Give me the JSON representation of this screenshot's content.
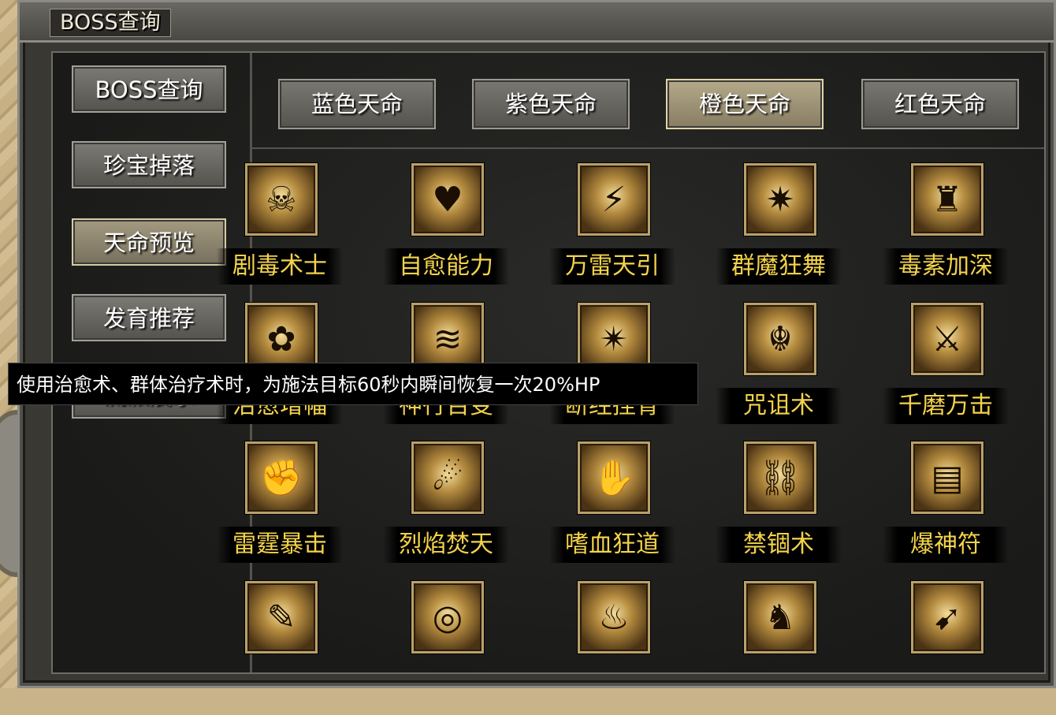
{
  "window": {
    "title": "BOSS查询"
  },
  "sidebar": {
    "items": [
      {
        "label": "BOSS查询"
      },
      {
        "label": "珍宝掉落"
      },
      {
        "label": "天命预览"
      },
      {
        "label": "发育推荐"
      },
      {
        "label": "流派展示"
      }
    ],
    "active_index": 2
  },
  "tabs": {
    "items": [
      {
        "label": "蓝色天命"
      },
      {
        "label": "紫色天命"
      },
      {
        "label": "橙色天命"
      },
      {
        "label": "红色天命"
      }
    ],
    "active_index": 2
  },
  "skills": [
    {
      "label": "剧毒术士",
      "icon": "skull-icon"
    },
    {
      "label": "自愈能力",
      "icon": "heart-icon"
    },
    {
      "label": "万雷天引",
      "icon": "lightning-icon"
    },
    {
      "label": "群魔狂舞",
      "icon": "demon-dance-icon"
    },
    {
      "label": "毒素加深",
      "icon": "warrior-icon"
    },
    {
      "label": "治愈增幅",
      "icon": "flower-icon"
    },
    {
      "label": "神行百变",
      "icon": "shadow-step-icon"
    },
    {
      "label": "断经挫骨",
      "icon": "burst-icon"
    },
    {
      "label": "咒诅术",
      "icon": "curse-icon"
    },
    {
      "label": "千磨万击",
      "icon": "slash-icon"
    },
    {
      "label": "雷霆暴击",
      "icon": "fist-icon"
    },
    {
      "label": "烈焰焚天",
      "icon": "fireball-icon"
    },
    {
      "label": "嗜血狂道",
      "icon": "claw-icon"
    },
    {
      "label": "禁锢术",
      "icon": "chain-icon"
    },
    {
      "label": "爆神符",
      "icon": "talisman-icon"
    },
    {
      "label": "",
      "icon": "feather-icon"
    },
    {
      "label": "",
      "icon": "vortex-icon"
    },
    {
      "label": "",
      "icon": "aura-icon"
    },
    {
      "label": "",
      "icon": "beast-icon"
    },
    {
      "label": "",
      "icon": "dash-icon"
    }
  ],
  "tooltip": {
    "text": "使用治愈术、群体治疗术时，为施法目标60秒内瞬间恢复一次20%HP"
  }
}
